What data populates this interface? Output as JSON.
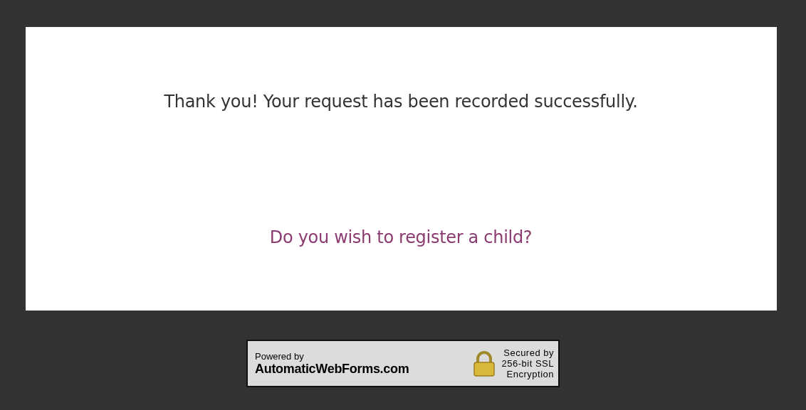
{
  "message": "Thank you! Your request has been recorded successfully.",
  "link": "Do you wish to register a child?",
  "badge": {
    "powered_by": "Powered by",
    "brand": "AutomaticWebForms.com",
    "secured_lines": [
      "Secured by",
      "256-bit SSL",
      "Encryption"
    ]
  }
}
